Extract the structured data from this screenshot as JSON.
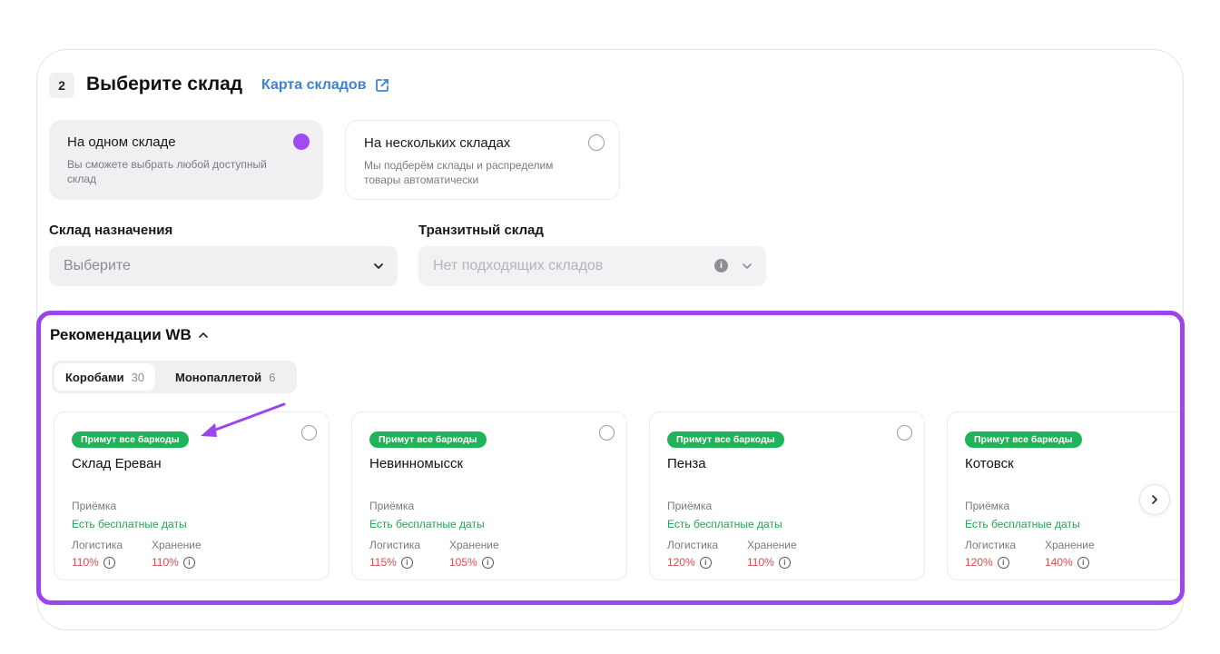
{
  "step": {
    "number": "2",
    "title": "Выберите склад",
    "map_link": "Карта складов"
  },
  "options": [
    {
      "title": "На одном складе",
      "desc": "Вы сможете выбрать любой доступный склад",
      "selected": true
    },
    {
      "title": "На нескольких складах",
      "desc": "Мы подберём склады и распределим товары автоматически",
      "selected": false
    }
  ],
  "fields": {
    "destination": {
      "label": "Склад назначения",
      "value": "Выберите"
    },
    "transit": {
      "label": "Транзитный склад",
      "value": "Нет подходящих складов",
      "info": "i"
    }
  },
  "reco": {
    "title": "Рекомендации WB",
    "tabs": [
      {
        "label": "Коробами",
        "count": "30"
      },
      {
        "label": "Монопаллетой",
        "count": "6"
      }
    ],
    "labels": {
      "badge": "Примут все баркоды",
      "acceptance": "Приёмка",
      "free_dates": "Есть бесплатные даты",
      "logistics": "Логистика",
      "storage": "Хранение",
      "info": "i"
    },
    "cards": [
      {
        "name": "Склад Ереван",
        "logistics": "110%",
        "storage": "110%"
      },
      {
        "name": "Невинномысск",
        "logistics": "115%",
        "storage": "105%"
      },
      {
        "name": "Пенза",
        "logistics": "120%",
        "storage": "110%"
      },
      {
        "name": "Котовск",
        "logistics": "120%",
        "storage": "140%"
      }
    ]
  },
  "colors": {
    "accent": "#9b45ec",
    "green": "#1fb45a",
    "red": "#e5484d",
    "link": "#3b82d6"
  }
}
